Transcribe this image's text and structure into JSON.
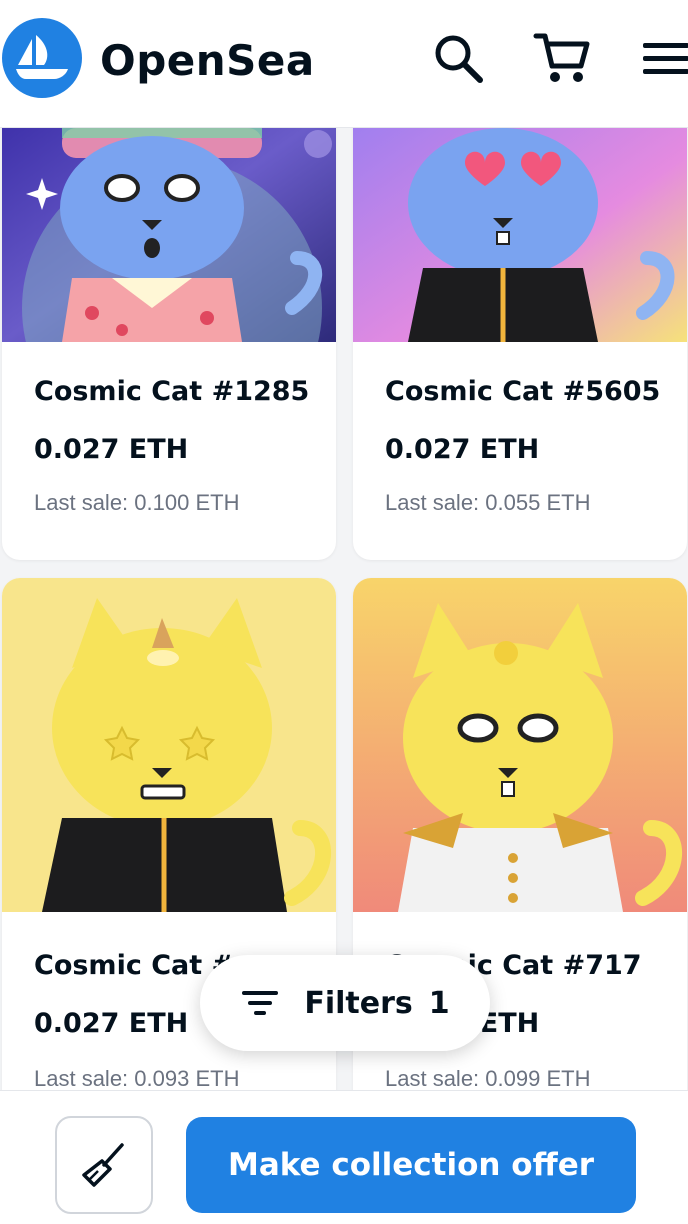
{
  "header": {
    "brand": "OpenSea",
    "logo_icon": "opensea-ship-icon",
    "search_icon": "search-icon",
    "cart_icon": "cart-icon",
    "menu_icon": "hamburger-menu-icon"
  },
  "items": [
    {
      "name": "Cosmic Cat #1285",
      "price": "0.027 ETH",
      "last_sale_label": "Last sale:",
      "last_sale_value": "0.100 ETH"
    },
    {
      "name": "Cosmic Cat #5605",
      "price": "0.027 ETH",
      "last_sale_label": "Last sale:",
      "last_sale_value": "0.055 ETH"
    },
    {
      "name": "Cosmic Cat #",
      "price": "0.027 ETH",
      "last_sale_label": "Last sale:",
      "last_sale_value": "0.093 ETH"
    },
    {
      "name": "Cosmic Cat #717",
      "price": "0.027 ETH",
      "last_sale_label": "Last sale:",
      "last_sale_value": "0.099 ETH"
    }
  ],
  "filters": {
    "label": "Filters",
    "count": "1",
    "icon": "filter-lines-icon"
  },
  "footer": {
    "sweep_icon": "broom-icon",
    "offer_label": "Make collection offer"
  },
  "colors": {
    "accent": "#2081e2",
    "text": "#04111d",
    "muted": "#6b7280"
  }
}
